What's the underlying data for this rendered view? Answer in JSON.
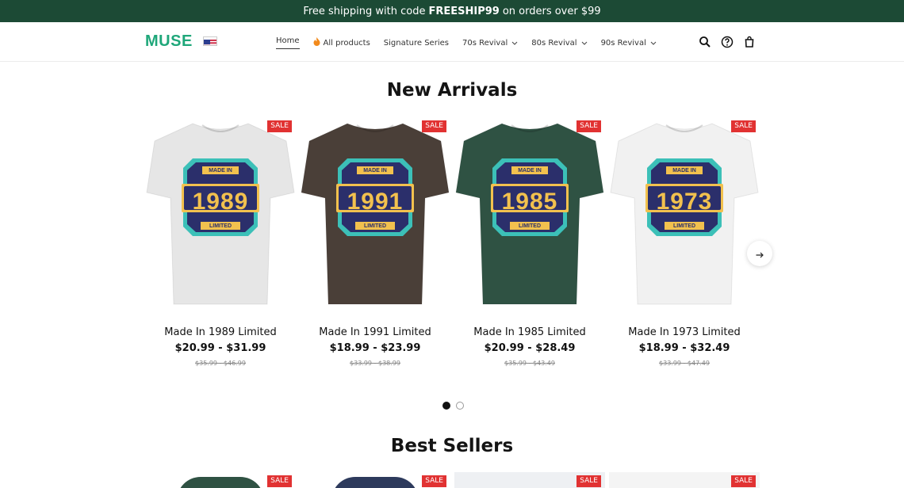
{
  "announcement": {
    "prefix": "Free shipping with code",
    "code": "FREESHIP99",
    "suffix": "on orders over $99"
  },
  "header": {
    "logo": "MUSE",
    "nav": [
      {
        "label": "Home",
        "active": true
      },
      {
        "label": "All products",
        "icon": "fire-icon"
      },
      {
        "label": "Signature Series"
      },
      {
        "label": "70s Revival",
        "dropdown": true
      },
      {
        "label": "80s Revival",
        "dropdown": true
      },
      {
        "label": "90s Revival",
        "dropdown": true
      }
    ],
    "icons": [
      "search-icon",
      "help-icon",
      "cart-icon"
    ]
  },
  "new_arrivals": {
    "title": "New Arrivals",
    "products": [
      {
        "name": "Made In 1989 Limited",
        "price": "$20.99 - $31.99",
        "compare": "$35.99 - $46.99",
        "badge": "SALE",
        "year": "1989",
        "shirt_color": "#e6e6e6"
      },
      {
        "name": "Made In 1991 Limited",
        "price": "$18.99 - $23.99",
        "compare": "$33.99 - $38.99",
        "badge": "SALE",
        "year": "1991",
        "shirt_color": "#4a3f38"
      },
      {
        "name": "Made In 1985 Limited",
        "price": "$20.99 - $28.49",
        "compare": "$35.99 - $43.49",
        "badge": "SALE",
        "year": "1985",
        "shirt_color": "#2f5243"
      },
      {
        "name": "Made In 1973 Limited",
        "price": "$18.99 - $32.49",
        "compare": "$33.99 - $47.49",
        "badge": "SALE",
        "year": "1973",
        "shirt_color": "#f1f1f1"
      }
    ]
  },
  "best_sellers": {
    "title": "Best Sellers",
    "badges": [
      "SALE",
      "SALE",
      "SALE",
      "SALE"
    ]
  },
  "colors": {
    "brand": "#1fa77a",
    "announce_bg": "#1c4a35",
    "sale": "#e13232",
    "badge_emblem": "#2b2f6b",
    "emblem_text": "#f2c14e"
  }
}
